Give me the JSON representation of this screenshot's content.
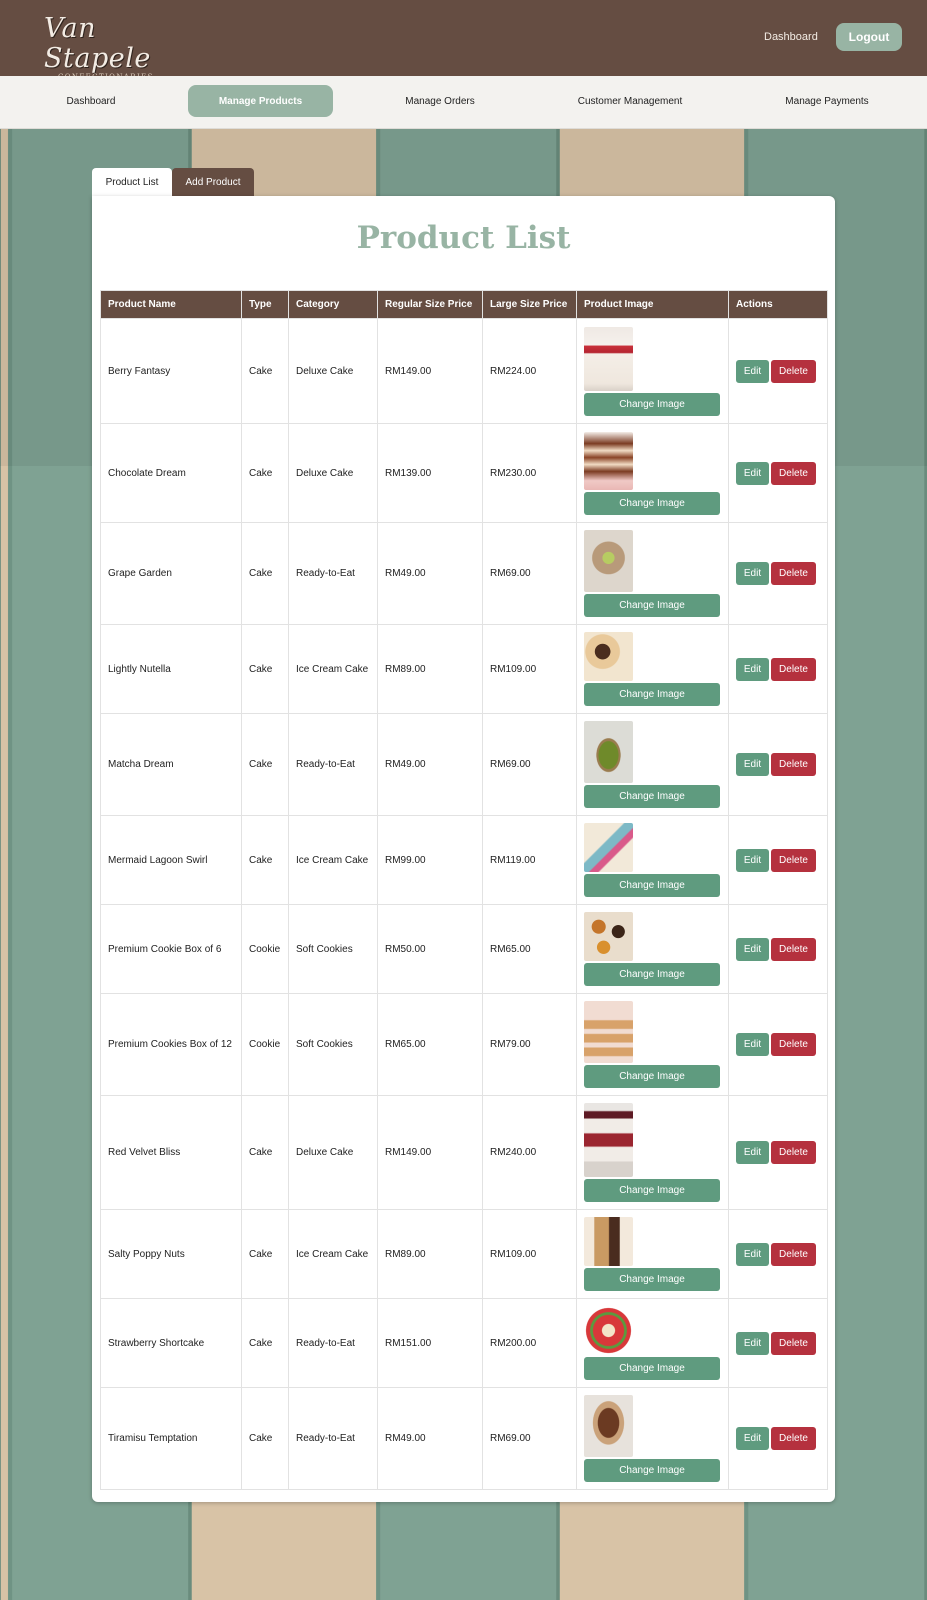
{
  "header": {
    "logo_text": "Van Stapele",
    "logo_subtext": "CONFECTIONARIES",
    "dashboard_link": "Dashboard",
    "logout_label": "Logout"
  },
  "nav": {
    "items": [
      {
        "label": "Dashboard",
        "active": false
      },
      {
        "label": "Manage Products",
        "active": true
      },
      {
        "label": "Manage Orders",
        "active": false
      },
      {
        "label": "Customer Management",
        "active": false
      },
      {
        "label": "Manage Payments",
        "active": false
      }
    ]
  },
  "tabs": [
    {
      "label": "Product List",
      "active": true
    },
    {
      "label": "Add Product",
      "active": false
    }
  ],
  "main": {
    "title": "Product List",
    "columns": [
      "Product Name",
      "Type",
      "Category",
      "Regular Size Price",
      "Large Size Price",
      "Product Image",
      "Actions"
    ],
    "change_image_label": "Change Image",
    "edit_label": "Edit",
    "delete_label": "Delete",
    "rows": [
      {
        "name": "Berry Fantasy",
        "type": "Cake",
        "category": "Deluxe Cake",
        "regular": "RM149.00",
        "large": "RM224.00",
        "image": "berry-cake"
      },
      {
        "name": "Chocolate Dream",
        "type": "Cake",
        "category": "Deluxe Cake",
        "regular": "RM139.00",
        "large": "RM230.00",
        "image": "chocolate-layer-cake"
      },
      {
        "name": "Grape Garden",
        "type": "Cake",
        "category": "Ready-to-Eat",
        "regular": "RM49.00",
        "large": "RM69.00",
        "image": "grape-cake"
      },
      {
        "name": "Lightly Nutella",
        "type": "Cake",
        "category": "Ice Cream Cake",
        "regular": "RM89.00",
        "large": "RM109.00",
        "image": "nutella-ice-cream-cake"
      },
      {
        "name": "Matcha Dream",
        "type": "Cake",
        "category": "Ready-to-Eat",
        "regular": "RM49.00",
        "large": "RM69.00",
        "image": "matcha-tart"
      },
      {
        "name": "Mermaid Lagoon Swirl",
        "type": "Cake",
        "category": "Ice Cream Cake",
        "regular": "RM99.00",
        "large": "RM119.00",
        "image": "mermaid-cake-slice"
      },
      {
        "name": "Premium Cookie Box of 6",
        "type": "Cookie",
        "category": "Soft Cookies",
        "regular": "RM50.00",
        "large": "RM65.00",
        "image": "cookie-box-6"
      },
      {
        "name": "Premium Cookies Box of 12",
        "type": "Cookie",
        "category": "Soft Cookies",
        "regular": "RM65.00",
        "large": "RM79.00",
        "image": "cookie-box-12"
      },
      {
        "name": "Red Velvet Bliss",
        "type": "Cake",
        "category": "Deluxe Cake",
        "regular": "RM149.00",
        "large": "RM240.00",
        "image": "red-velvet-cake"
      },
      {
        "name": "Salty Poppy Nuts",
        "type": "Cake",
        "category": "Ice Cream Cake",
        "regular": "RM89.00",
        "large": "RM109.00",
        "image": "poppy-nut-slice"
      },
      {
        "name": "Strawberry Shortcake",
        "type": "Cake",
        "category": "Ready-to-Eat",
        "regular": "RM151.00",
        "large": "RM200.00",
        "image": "strawberry-shortcake"
      },
      {
        "name": "Tiramisu Temptation",
        "type": "Cake",
        "category": "Ready-to-Eat",
        "regular": "RM49.00",
        "large": "RM69.00",
        "image": "tiramisu-cake"
      }
    ]
  },
  "colors": {
    "brown": "#654d42",
    "sage": "#98b4a4",
    "green_button": "#5f9b7f",
    "delete_red": "#b5313e"
  }
}
